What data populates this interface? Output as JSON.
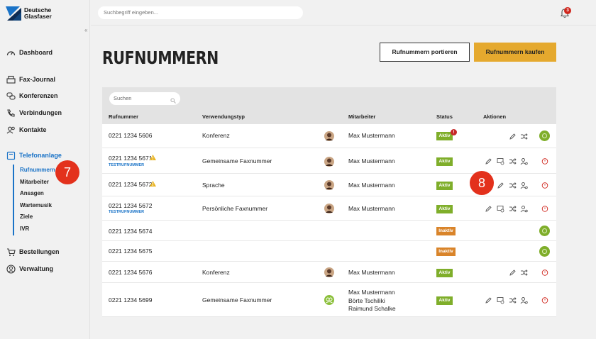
{
  "brand": {
    "line1": "Deutsche",
    "line2": "Glasfaser",
    "color": "#1a73c7"
  },
  "search": {
    "placeholder": "Suchbegriff eingeben..."
  },
  "notifications": {
    "count": "3"
  },
  "nav": {
    "dashboard": "Dashboard",
    "fax_journal": "Fax-Journal",
    "konferenzen": "Konferenzen",
    "verbindungen": "Verbindungen",
    "kontakte": "Kontakte",
    "telefonanlage": "Telefonanlage",
    "sub": [
      "Rufnummern",
      "Mitarbeiter",
      "Ansagen",
      "Wartemusik",
      "Ziele",
      "IVR"
    ],
    "bestellungen": "Bestellungen",
    "verwaltung": "Verwaltung"
  },
  "page": {
    "title": "RUFNUMMERN",
    "btn_port": "Rufnummern portieren",
    "btn_buy": "Rufnummern kaufen"
  },
  "table": {
    "search_placeholder": "Suchen",
    "headers": {
      "number": "Rufnummer",
      "use": "Verwendungstyp",
      "employee": "Mitarbeiter",
      "status": "Status",
      "actions": "Aktionen"
    },
    "rows": [
      {
        "number": "0221 1234 5606",
        "use": "Konferenz",
        "employees": [
          "Max Mustermann"
        ],
        "status": "Aktiv"
      },
      {
        "number": "0221 1234 5671",
        "tag": "TESTRUFNUMMER",
        "use": "Gemeinsame Faxnummer",
        "employees": [
          "Max Mustermann"
        ],
        "status": "Aktiv"
      },
      {
        "number": "0221 1234 5672",
        "use": "Sprache",
        "employees": [
          "Max Mustermann"
        ],
        "status": "Aktiv"
      },
      {
        "number": "0221 1234 5672",
        "tag": "TESTRUFNUMMER",
        "use": "Persönliche Faxnummer",
        "employees": [
          "Max Mustermann"
        ],
        "status": "Aktiv"
      },
      {
        "number": "0221 1234 5674",
        "use": "",
        "employees": [],
        "status": "Inaktiv"
      },
      {
        "number": "0221 1234 5675",
        "use": "",
        "employees": [],
        "status": "Inaktiv"
      },
      {
        "number": "0221 1234 5676",
        "use": "Konferenz",
        "employees": [
          "Max Mustermann"
        ],
        "status": "Aktiv"
      },
      {
        "number": "0221 1234 5699",
        "use": "Gemeinsame Faxnummer",
        "employees": [
          "Max Mustermann",
          "Börte Tschiliki",
          "Raimund Schalke"
        ],
        "status": "Aktiv"
      }
    ]
  },
  "steps": {
    "seven": "7",
    "eight": "8"
  },
  "colors": {
    "accent": "#1a73c7",
    "buy": "#e5a92e",
    "active": "#7fae2a",
    "inactive": "#d9842a",
    "alert": "#e3311c"
  }
}
